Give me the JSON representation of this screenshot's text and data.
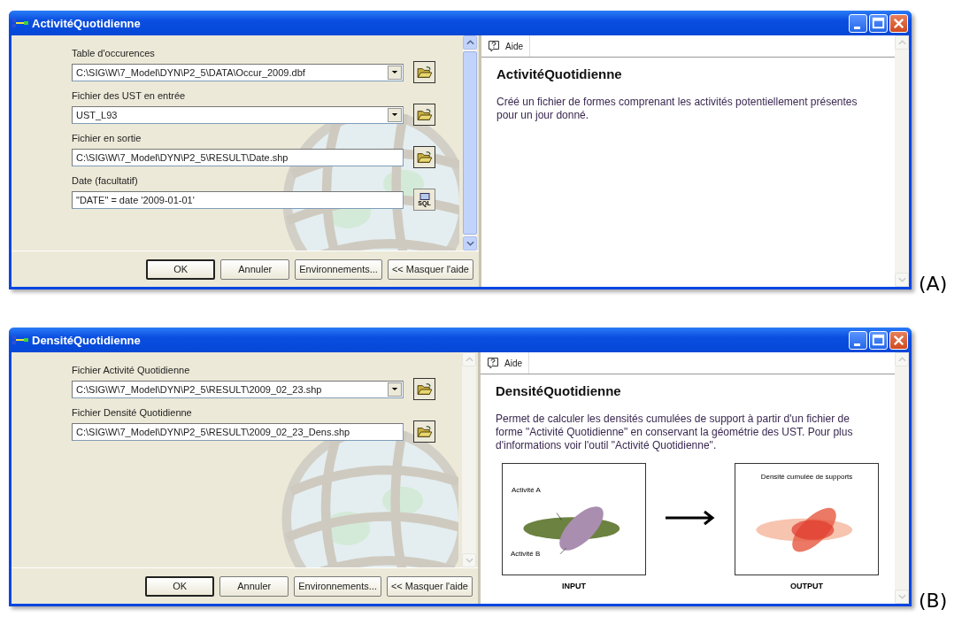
{
  "windows": [
    {
      "title": "ActivitéQuotidienne",
      "panel_label": "(A)",
      "scrollable": true,
      "fields": [
        {
          "label": "Table d'occurences",
          "value": "C:\\SIG\\W\\7_Model\\DYN\\P2_5\\DATA\\Occur_2009.dbf",
          "kind": "dropdown"
        },
        {
          "label": "Fichier des UST en entrée",
          "value": "UST_L93",
          "kind": "dropdown"
        },
        {
          "label": "Fichier en sortie",
          "value": "C:\\SIG\\W\\7_Model\\DYN\\P2_5\\RESULT\\Date.shp",
          "kind": "file"
        },
        {
          "label": "Date (facultatif)",
          "value": "\"DATE\" = date '2009-01-01'",
          "kind": "query",
          "button_text": "SQL"
        }
      ],
      "buttons": [
        "OK",
        "Annuler",
        "Environnements...",
        "<< Masquer l'aide"
      ],
      "help": {
        "tab": "Aide",
        "heading": "ActivitéQuotidienne",
        "text": "Créé un fichier de formes comprenant les activités potentiellement présentes pour un jour donné."
      }
    },
    {
      "title": "DensitéQuotidienne",
      "panel_label": "(B)",
      "scrollable": false,
      "fields": [
        {
          "label": "Fichier Activité Quotidienne",
          "value": "C:\\SIG\\W\\7_Model\\DYN\\P2_5\\RESULT\\2009_02_23.shp",
          "kind": "dropdown"
        },
        {
          "label": "Fichier Densité Quotidienne",
          "value": "C:\\SIG\\W\\7_Model\\DYN\\P2_5\\RESULT\\2009_02_23_Dens.shp",
          "kind": "file"
        }
      ],
      "buttons": [
        "OK",
        "Annuler",
        "Environnements...",
        "<< Masquer l'aide"
      ],
      "help": {
        "tab": "Aide",
        "heading": "DensitéQuotidienne",
        "text": "Permet de calculer les densités cumulées de support à partir d'un fichier de forme \"Activité Quotidienne\" en conservant la géométrie des UST. Pour plus d'informations voir l'outil \"Activité Quotidienne\".",
        "figure": {
          "input": {
            "labels": [
              "Activité A",
              "Activité B"
            ],
            "caption": "INPUT"
          },
          "output": {
            "title": "Densité cumulée de supports",
            "caption": "OUTPUT"
          }
        }
      }
    }
  ]
}
